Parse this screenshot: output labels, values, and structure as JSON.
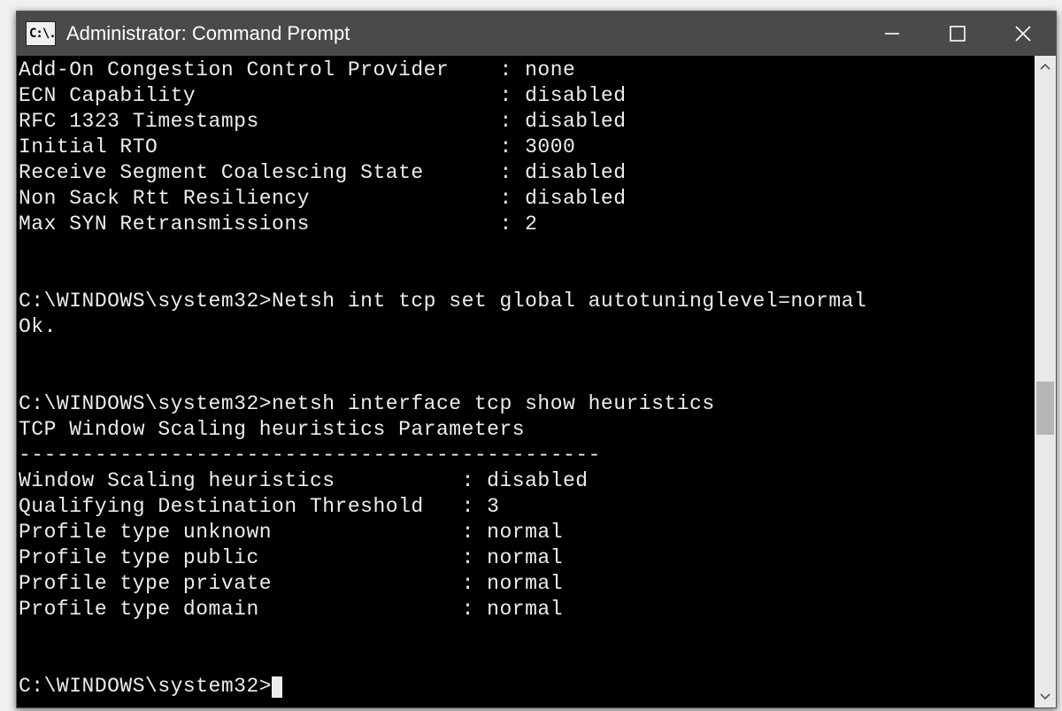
{
  "window": {
    "title": "Administrator: Command Prompt",
    "icon_text": "C:\\."
  },
  "terminal": {
    "prompt": "C:\\WINDOWS\\system32>",
    "section1": {
      "rows": [
        {
          "label": "Add-On Congestion Control Provider",
          "value": "none"
        },
        {
          "label": "ECN Capability",
          "value": "disabled"
        },
        {
          "label": "RFC 1323 Timestamps",
          "value": "disabled"
        },
        {
          "label": "Initial RTO",
          "value": "3000"
        },
        {
          "label": "Receive Segment Coalescing State",
          "value": "disabled"
        },
        {
          "label": "Non Sack Rtt Resiliency",
          "value": "disabled"
        },
        {
          "label": "Max SYN Retransmissions",
          "value": "2"
        }
      ]
    },
    "cmd1": {
      "command": "Netsh int tcp set global autotuninglevel=normal",
      "response": "Ok."
    },
    "cmd2": {
      "command": "netsh interface tcp show heuristics",
      "header": "TCP Window Scaling heuristics Parameters",
      "divider": "----------------------------------------------",
      "rows": [
        {
          "label": "Window Scaling heuristics",
          "value": "disabled"
        },
        {
          "label": "Qualifying Destination Threshold",
          "value": "3"
        },
        {
          "label": "Profile type unknown",
          "value": "normal"
        },
        {
          "label": "Profile type public",
          "value": "normal"
        },
        {
          "label": "Profile type private",
          "value": "normal"
        },
        {
          "label": "Profile type domain",
          "value": "normal"
        }
      ]
    }
  }
}
